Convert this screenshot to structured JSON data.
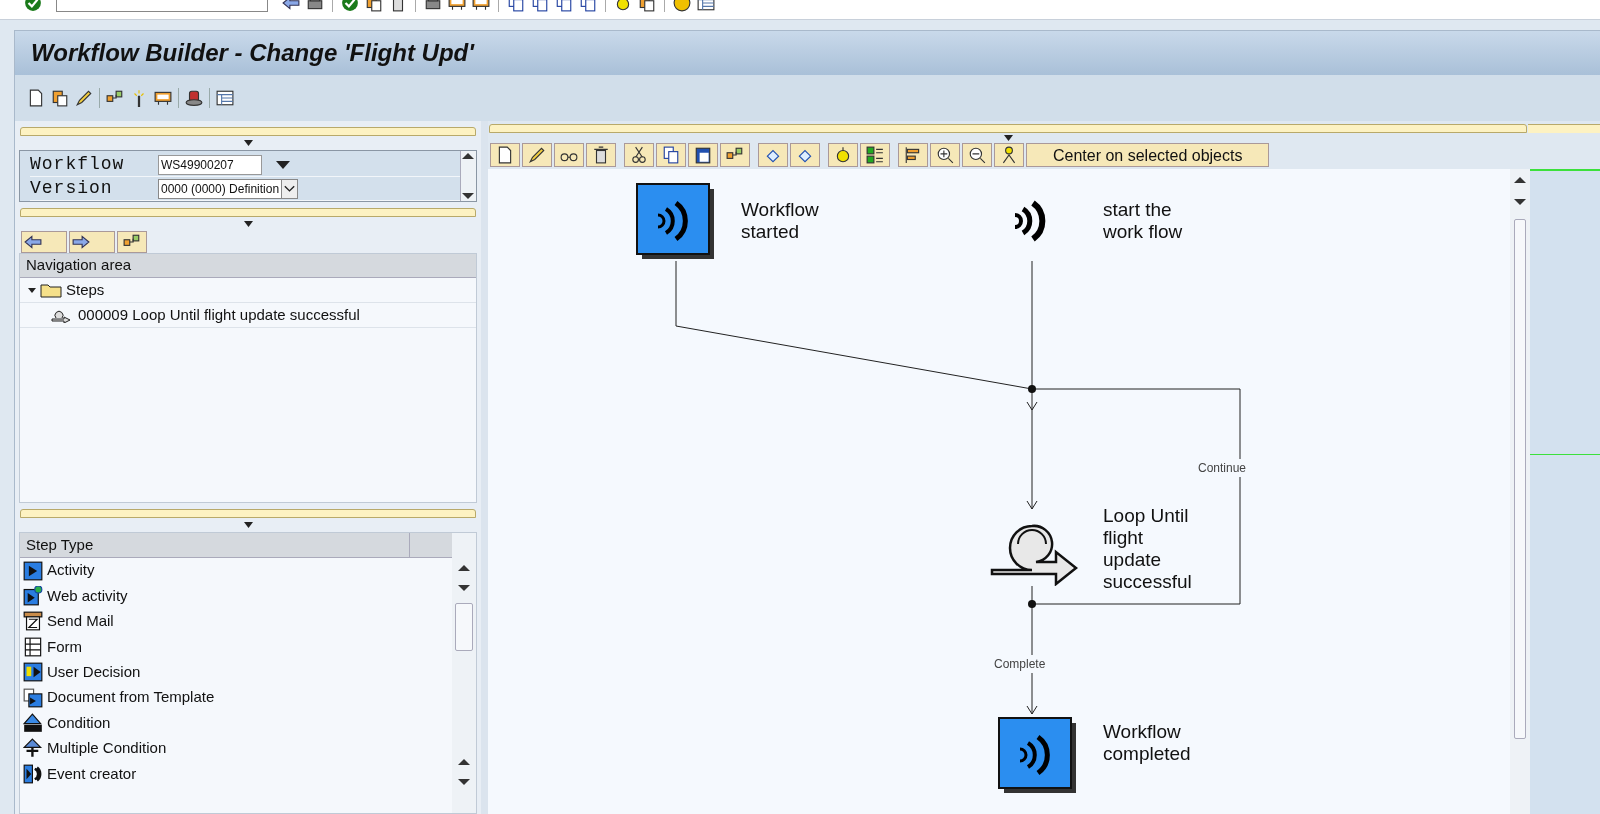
{
  "window": {
    "title": "Workflow Builder - Change 'Flight Upd'"
  },
  "header_fields": [
    {
      "kind": "input",
      "label": "Workflow",
      "value": "WS49900207"
    },
    {
      "kind": "select",
      "label": "Version",
      "value": "0000 (0000) Definition"
    }
  ],
  "navigation": {
    "header": "Navigation area",
    "tree": [
      {
        "label": "Steps",
        "expanded": true,
        "children": [
          {
            "label": "000009 Loop Until flight update successful"
          }
        ]
      }
    ]
  },
  "step_types": {
    "header": "Step Type",
    "items": [
      "Activity",
      "Web activity",
      "Send Mail",
      "Form",
      "User Decision",
      "Document from Template",
      "Condition",
      "Multiple Condition",
      "Event creator"
    ]
  },
  "canvas_toolbar": {
    "button": "Center on selected objects"
  },
  "diagram": {
    "nodes": [
      {
        "kind": "event",
        "lines": [
          "Workflow",
          "started"
        ]
      },
      {
        "kind": "start",
        "lines": [
          "start the",
          "work flow"
        ]
      },
      {
        "kind": "loop",
        "lines": [
          "Loop Until",
          "flight",
          "update",
          "successful"
        ]
      },
      {
        "kind": "event",
        "lines": [
          "Workflow",
          "completed"
        ]
      }
    ],
    "edge_labels": [
      "Continue",
      "Complete"
    ]
  }
}
